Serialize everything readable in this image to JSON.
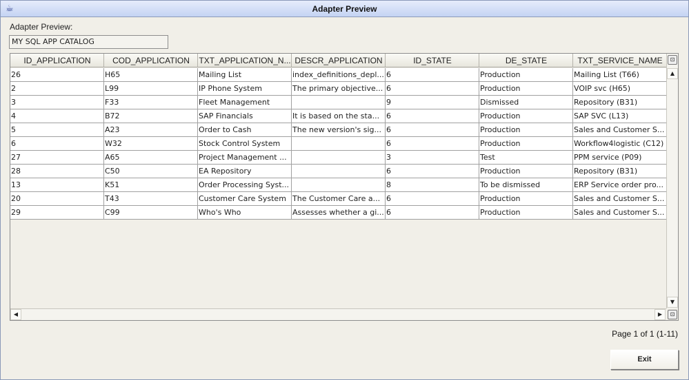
{
  "window": {
    "title": "Adapter Preview"
  },
  "adapter": {
    "label": "Adapter Preview:",
    "value": "MY SQL APP CATALOG"
  },
  "table": {
    "columns": [
      "ID_APPLICATION",
      "COD_APPLICATION",
      "TXT_APPLICATION_N...",
      "DESCR_APPLICATION",
      "ID_STATE",
      "DE_STATE",
      "TXT_SERVICE_NAME"
    ],
    "rows": [
      [
        "26",
        "H65",
        "Mailing List",
        "index_definitions_depl...",
        "6",
        "Production",
        "Mailing List (T66)"
      ],
      [
        "2",
        "L99",
        "IP Phone System",
        "The primary objective...",
        "6",
        "Production",
        "VOIP svc (H65)"
      ],
      [
        "3",
        "F33",
        "Fleet Management",
        "",
        "9",
        "Dismissed",
        "Repository (B31)"
      ],
      [
        "4",
        "B72",
        "SAP Financials",
        "It is based on the sta...",
        "6",
        "Production",
        "SAP SVC (L13)"
      ],
      [
        "5",
        "A23",
        "Order to Cash",
        "The new version's sig...",
        "6",
        "Production",
        "Sales and Customer S..."
      ],
      [
        "6",
        "W32",
        "Stock Control System",
        "",
        "6",
        "Production",
        "Workflow4logistic (C12)"
      ],
      [
        "27",
        "A65",
        "Project Management ...",
        "",
        "3",
        "Test",
        "PPM service (P09)"
      ],
      [
        "28",
        "C50",
        "EA Repository",
        "",
        "6",
        "Production",
        "Repository (B31)"
      ],
      [
        "13",
        "K51",
        "Order Processing Syst...",
        "",
        "8",
        "To be  dismissed",
        "ERP Service order pro..."
      ],
      [
        "20",
        "T43",
        "Customer Care System",
        "The Customer Care a...",
        "6",
        "Production",
        "Sales and Customer S..."
      ],
      [
        "29",
        "C99",
        "Who's Who",
        "Assesses whether a gi...",
        "6",
        "Production",
        "Sales and Customer S..."
      ]
    ]
  },
  "pagination": {
    "text": "Page 1 of 1 (1-11)"
  },
  "buttons": {
    "exit": "Exit"
  }
}
